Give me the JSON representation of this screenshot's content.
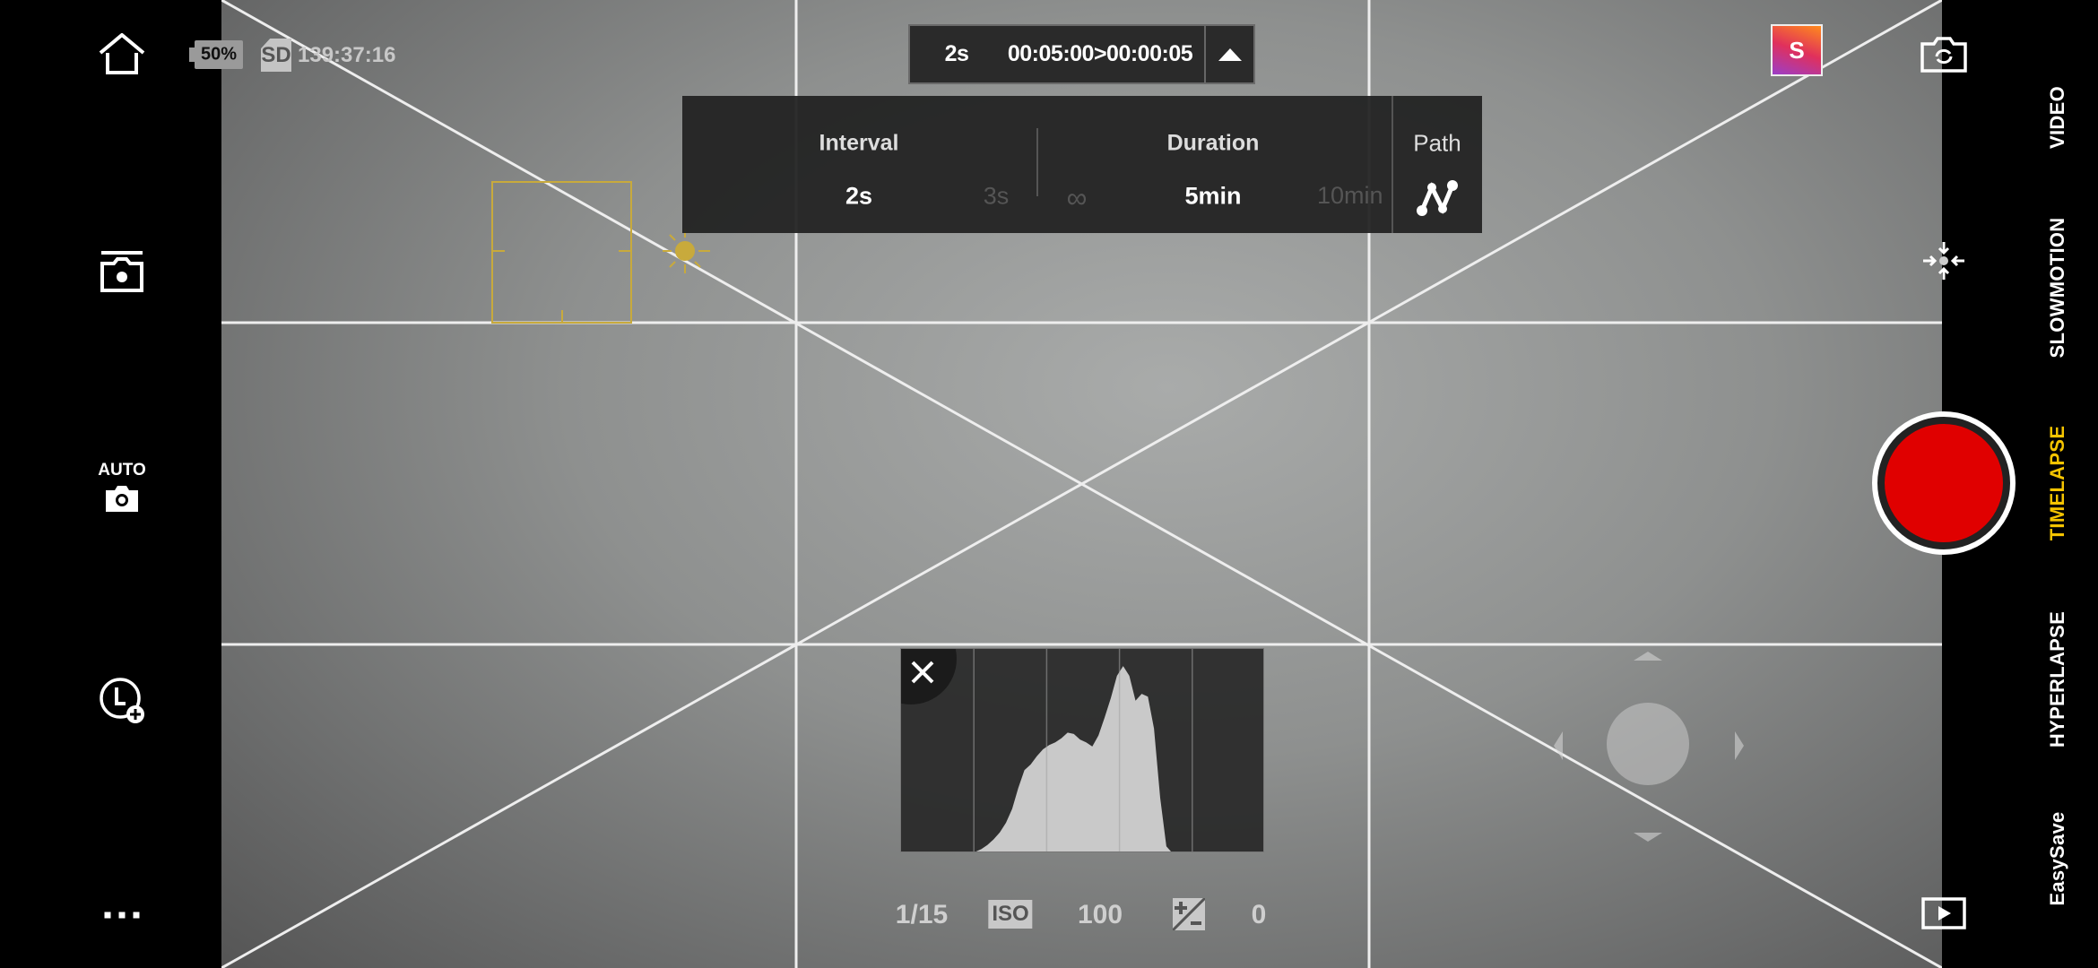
{
  "status": {
    "battery": "50%",
    "storage_label": "SD",
    "remaining_time": "139:37:16"
  },
  "summary_pill": {
    "interval": "2s",
    "timecode": "00:05:00>00:00:05",
    "collapse_icon": "triangle-up-icon"
  },
  "settings_panel": {
    "interval": {
      "label": "Interval",
      "options": [
        "2s",
        "3s"
      ],
      "selected": "2s"
    },
    "duration": {
      "label": "Duration",
      "options": [
        "∞",
        "5min",
        "10min"
      ],
      "selected": "5min"
    },
    "path": {
      "label": "Path",
      "icon": "path-nodes-icon"
    }
  },
  "left_toolbar": {
    "auto_label": "AUTO",
    "icons": [
      "home-icon",
      "capture-settings-icon",
      "auto-camera-icon",
      "timer-add-icon",
      "more-icon"
    ]
  },
  "exposure": {
    "shutter": "1/15",
    "iso_label": "ISO",
    "iso": "100",
    "ev_icon": "exposure-compensation-icon",
    "ev": "0"
  },
  "histogram": {
    "values": [
      0,
      0,
      0,
      0,
      0,
      0,
      0,
      0,
      0,
      0,
      0,
      0,
      1,
      3,
      6,
      10,
      15,
      22,
      32,
      47,
      60,
      64,
      70,
      75,
      78,
      80,
      83,
      87,
      86,
      82,
      80,
      77,
      85,
      98,
      112,
      128,
      135,
      128,
      110,
      115,
      113,
      90,
      40,
      5,
      0,
      0,
      0,
      0,
      0,
      0,
      0,
      0,
      0,
      0,
      0,
      0,
      0,
      0,
      0,
      0
    ]
  },
  "modes": {
    "items": [
      "VIDEO",
      "SLOWMOTION",
      "TIMELAPSE",
      "HYPERLAPSE",
      "EasySave"
    ],
    "active": "TIMELAPSE"
  },
  "profile_badge": "S",
  "colors": {
    "active_mode": "#f5c400",
    "record": "#e00000",
    "focus_box": "#c8aa3c"
  }
}
